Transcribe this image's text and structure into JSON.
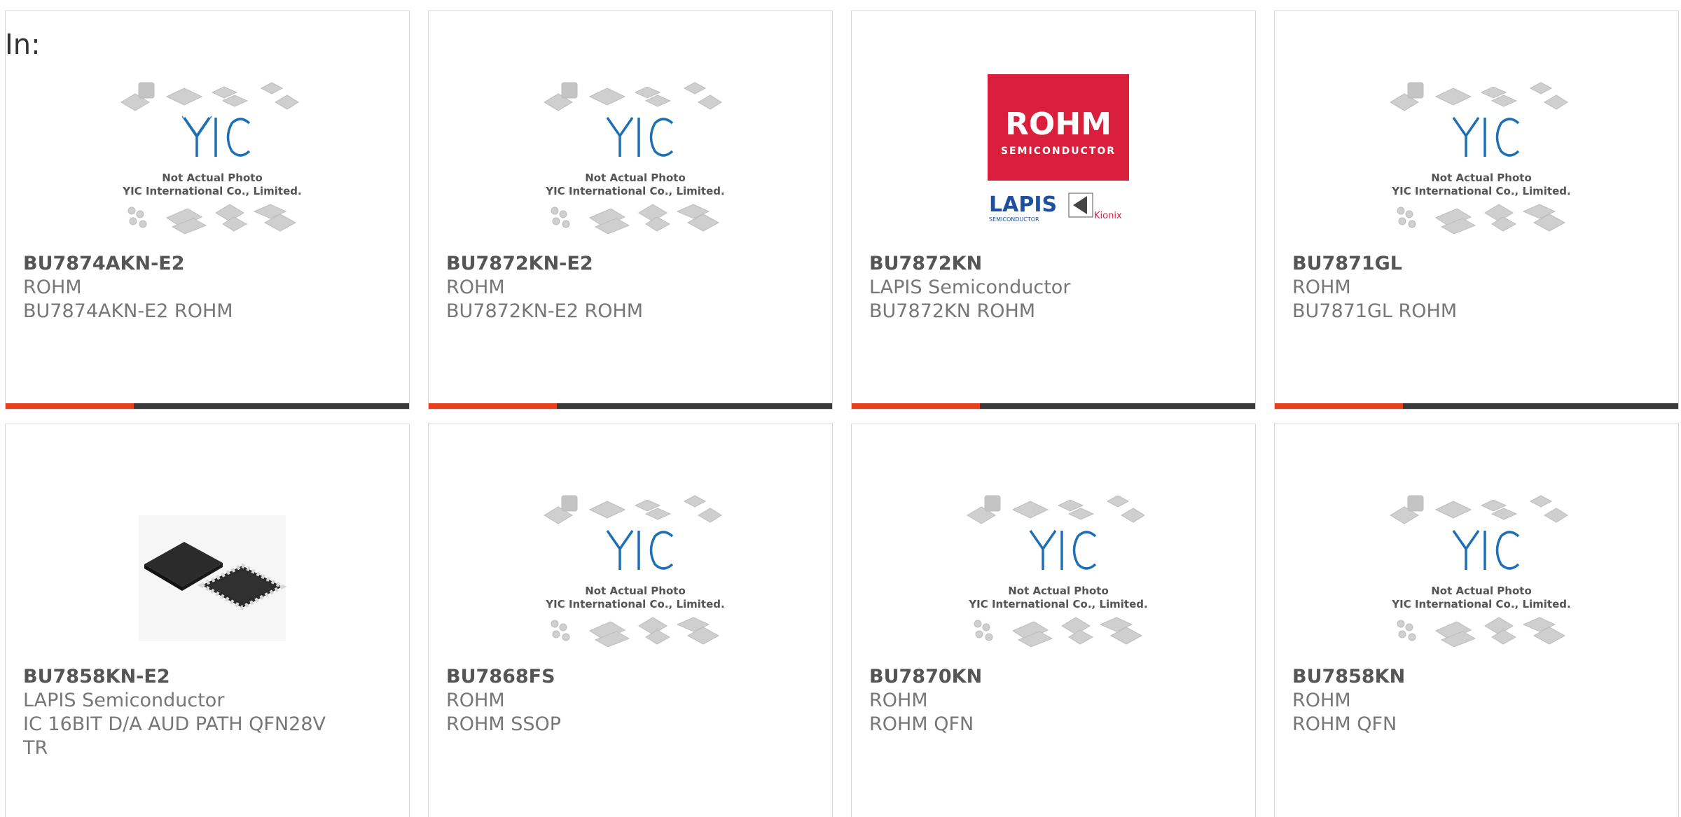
{
  "prefix": "In:",
  "placeholder_caption": {
    "line1": "Not Actual Photo",
    "line2": "YIC International Co., Limited.",
    "logo": "YIC"
  },
  "rohm_logo": {
    "brand": "ROHM",
    "sub": "SEMICONDUCTOR",
    "lapis": "LAPIS",
    "lapis_sub": "SEMICONDUCTOR",
    "kionix": "Kionix"
  },
  "colors": {
    "accent": "#e8401c",
    "bar": "#3a3a3a",
    "rohm_red": "#d91f3c",
    "yic_blue": "#1f6fb5"
  },
  "products": [
    {
      "part": "BU7874AKN-E2",
      "manufacturer": "ROHM",
      "description": "BU7874AKN-E2 ROHM",
      "image": "placeholder"
    },
    {
      "part": "BU7872KN-E2",
      "manufacturer": "ROHM",
      "description": "BU7872KN-E2 ROHM",
      "image": "placeholder"
    },
    {
      "part": "BU7872KN",
      "manufacturer": "LAPIS Semiconductor",
      "description": "BU7872KN ROHM",
      "image": "rohm-logo"
    },
    {
      "part": "BU7871GL",
      "manufacturer": "ROHM",
      "description": "BU7871GL ROHM",
      "image": "placeholder"
    },
    {
      "part": "BU7858KN-E2",
      "manufacturer": "LAPIS Semiconductor",
      "description": "IC 16BIT D/A AUD PATH QFN28V TR",
      "image": "qfn-chip"
    },
    {
      "part": "BU7868FS",
      "manufacturer": "ROHM",
      "description": "ROHM SSOP",
      "image": "placeholder"
    },
    {
      "part": "BU7870KN",
      "manufacturer": "ROHM",
      "description": "ROHM QFN",
      "image": "placeholder"
    },
    {
      "part": "BU7858KN",
      "manufacturer": "ROHM",
      "description": "ROHM QFN",
      "image": "placeholder"
    }
  ]
}
